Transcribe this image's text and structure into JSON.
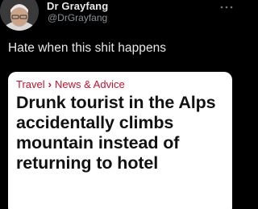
{
  "author": {
    "display_name": "Dr Grayfang",
    "handle": "@DrGrayfang"
  },
  "tweet": {
    "text": "Hate when this shit happens"
  },
  "card": {
    "breadcrumb": [
      "Travel",
      "News & Advice"
    ],
    "headline": "Drunk tourist in the Alps accidentally climbs mountain instead of returning to hotel"
  },
  "colors": {
    "background": "#000000",
    "breadcrumb_red": "#c8102e",
    "handle_grey": "#8b9298"
  },
  "icons": [
    "avatar",
    "more-icon",
    "chevron-right-icon"
  ]
}
